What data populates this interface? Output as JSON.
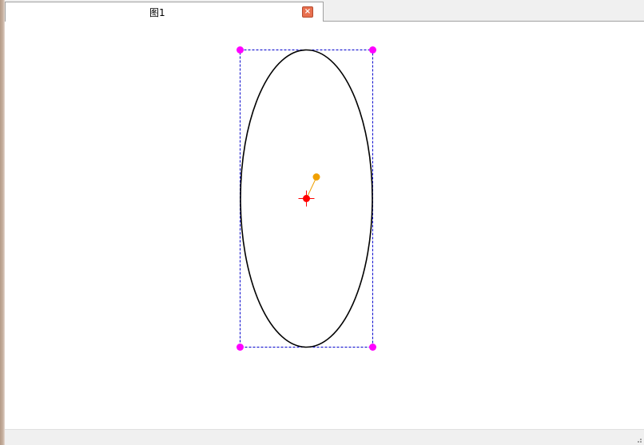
{
  "tabs": [
    {
      "label": "图1",
      "active": true
    }
  ],
  "icons": {
    "close": "close-icon",
    "resize": "resize-grip-icon"
  },
  "colors": {
    "selection_box": "#0000cc",
    "corner_handle": "#ff00ff",
    "ellipse_stroke": "#000000",
    "center_marker": "#ff0000",
    "rotation_handle": "#f0a000",
    "close_button": "#e8704f"
  }
}
